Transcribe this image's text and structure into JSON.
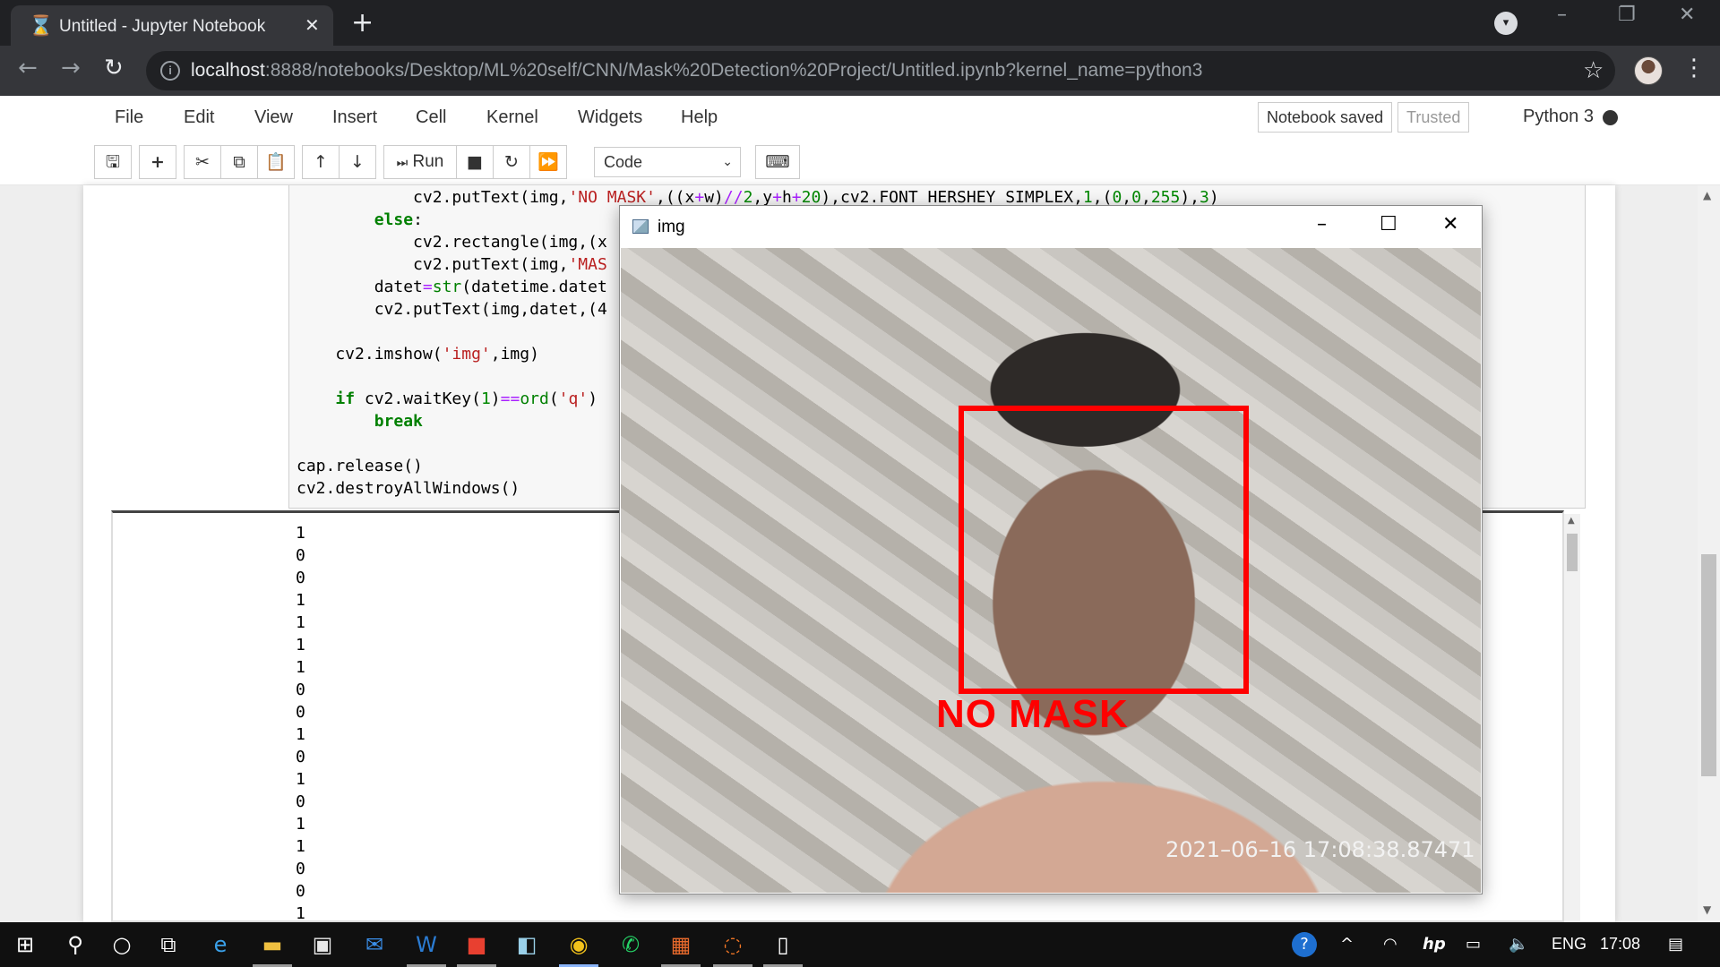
{
  "browser": {
    "tab_title": "Untitled - Jupyter Notebook",
    "tab_icon": "hourglass-icon",
    "new_tab_symbol": "+",
    "url_host": "localhost",
    "url_rest": ":8888/notebooks/Desktop/ML%20self/CNN/Mask%20Detection%20Project/Untitled.ipynb?kernel_name=python3"
  },
  "jupyter": {
    "menu": [
      "File",
      "Edit",
      "View",
      "Insert",
      "Cell",
      "Kernel",
      "Widgets",
      "Help"
    ],
    "notebook_status": "Notebook saved",
    "trusted_label": "Trusted",
    "kernel_name": "Python 3",
    "run_label": "Run",
    "cell_type": "Code"
  },
  "code_lines": [
    "            cv2.putText(img,'NO MASK',((x+w)//2,y+h+20),cv2.FONT_HERSHEY_SIMPLEX,1,(0,0,255),3)",
    "        else:",
    "            cv2.rectangle(img,(x",
    "            cv2.putText(img,'MAS",
    "        datet=str(datetime.datet",
    "        cv2.putText(img,datet,(4",
    "",
    "    cv2.imshow('img',img)",
    "",
    "    if cv2.waitKey(1)==ord('q')",
    "        break",
    "",
    "cap.release()",
    "cv2.destroyAllWindows()"
  ],
  "output_values": [
    "1",
    "0",
    "0",
    "1",
    "1",
    "1",
    "1",
    "0",
    "0",
    "1",
    "0",
    "1",
    "0",
    "1",
    "1",
    "0",
    "0",
    "1"
  ],
  "cv_window": {
    "title": "img",
    "detection_label": "NO MASK",
    "timestamp": "2021–06–16  17:08:38.87471"
  },
  "taskbar": {
    "language": "ENG",
    "time": "17:08"
  },
  "colors": {
    "detection_box": "#ff0000",
    "jupyter_orange": "#f37726",
    "chrome_dark": "#202124"
  }
}
